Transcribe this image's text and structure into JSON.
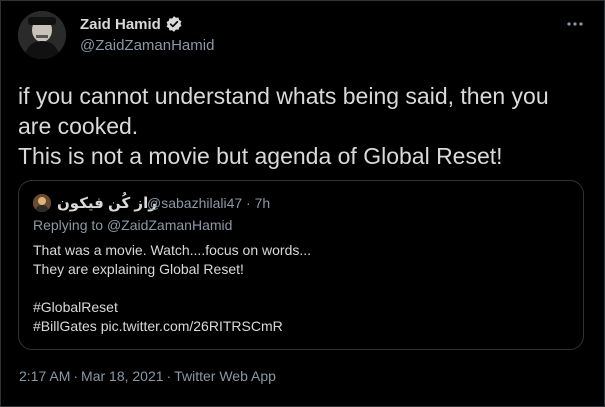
{
  "author": {
    "name": "Zaid Hamid",
    "handle": "@ZaidZamanHamid",
    "verified": true
  },
  "tweet": {
    "text": "if you cannot understand whats being said, then you\nare cooked.\nThis is not a movie but agenda of Global Reset!"
  },
  "quoted": {
    "name": "راز کُن فیکون",
    "handle": "@sabazhilali47",
    "dot": "·",
    "time": "7h",
    "replying_prefix": "Replying to",
    "replying_to": "@ZaidZamanHamid",
    "lines": [
      "That was a movie. Watch....focus on words...",
      "They are explaining Global Reset!",
      "",
      "#GlobalReset",
      "#BillGates pic.twitter.com/26RITRSCmR"
    ]
  },
  "footer": {
    "time": "2:17 AM",
    "sep1": "·",
    "date": "Mar 18, 2021",
    "sep2": "·",
    "source": "Twitter Web App"
  },
  "colors": {
    "background": "#000000",
    "text": "#d9d9d9",
    "secondary": "#8b98a5",
    "border": "#2f3336",
    "verified": "#d9d9d9"
  }
}
